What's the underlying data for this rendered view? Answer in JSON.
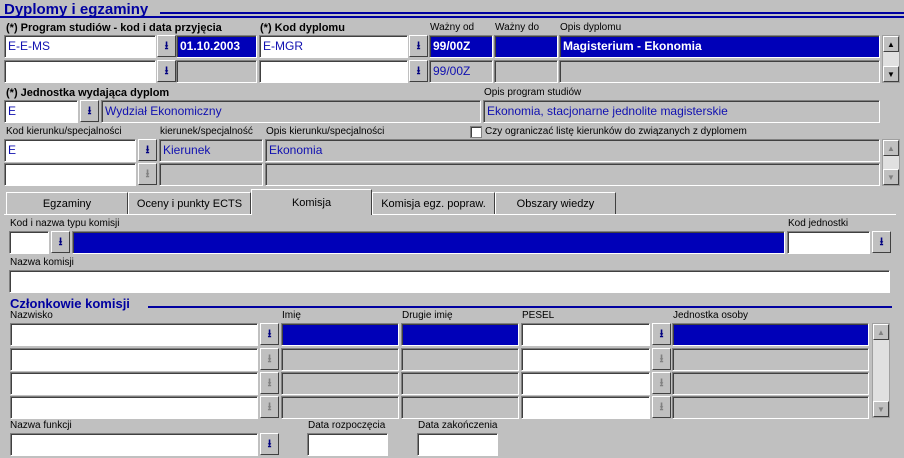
{
  "header": {
    "title": "Dyplomy i egzaminy"
  },
  "program": {
    "label": "(*) Program studiów - kod i data przyjęcia",
    "rows": [
      {
        "code": "E-E-MS",
        "date": "01.10.2003"
      },
      {
        "code": "",
        "date": ""
      }
    ]
  },
  "diploma": {
    "code_label": "(*) Kod dyplomu",
    "valid_from_label": "Ważny od",
    "valid_to_label": "Ważny do",
    "desc_label": "Opis dyplomu",
    "rows": [
      {
        "code": "E-MGR",
        "valid_from": "99/00Z",
        "valid_to": "",
        "desc": "Magisterium - Ekonomia"
      },
      {
        "code": "",
        "valid_from": "99/00Z",
        "valid_to": "",
        "desc": ""
      }
    ]
  },
  "unit": {
    "label": "(*) Jednostka wydająca dyplom",
    "code": "E",
    "name": "Wydział Ekonomiczny",
    "program_desc_label": "Opis program studiów",
    "program_desc": "Ekonomia, stacjonarne jednolite magisterskie"
  },
  "direction": {
    "code_label": "Kod kierunku/specjalności",
    "type_label": "kierunek/specjalność",
    "desc_label": "Opis kierunku/specjalności",
    "limit_label": "Czy ograniczać listę kierunków do związanych z dyplomem",
    "rows": [
      {
        "code": "E",
        "type": "Kierunek",
        "desc": "Ekonomia"
      },
      {
        "code": "",
        "type": "",
        "desc": ""
      }
    ]
  },
  "tabs": [
    "Egzaminy",
    "Oceny i punkty ECTS",
    "Komisja",
    "Komisja egz. popraw.",
    "Obszary wiedzy"
  ],
  "commission": {
    "type_label": "Kod i nazwa typu komisji",
    "unit_label": "Kod jednostki",
    "name_label": "Nazwa komisji",
    "type_code": "",
    "type_name": "",
    "unit_code": "",
    "name": ""
  },
  "members": {
    "title": "Członkowie komisji",
    "cols": {
      "surname": "Nazwisko",
      "first": "Imię",
      "second": "Drugie imię",
      "pesel": "PESEL",
      "unit": "Jednostka osoby"
    },
    "function_label": "Nazwa funkcji",
    "start_label": "Data rozpoczęcia",
    "end_label": "Data zakończenia",
    "function": "",
    "start": "",
    "end": ""
  },
  "icons": {
    "lookup": "down-arrow-lookup-icon",
    "scroll_up": "scroll-up-icon",
    "scroll_down": "scroll-down-icon"
  },
  "colors": {
    "selection": "#0000b8",
    "section": "#0000a0",
    "background": "#c0c0c0"
  }
}
